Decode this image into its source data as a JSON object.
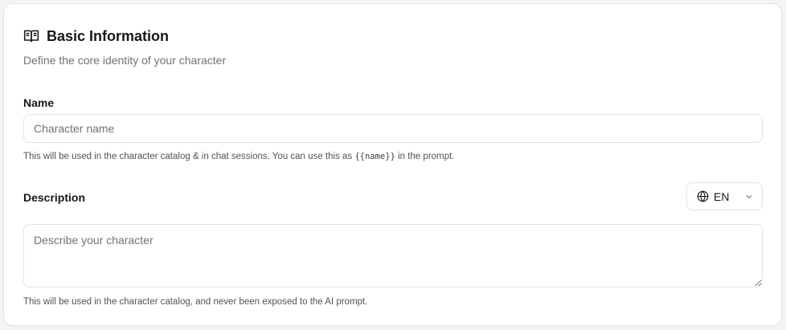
{
  "section": {
    "title": "Basic Information",
    "subtitle": "Define the core identity of your character",
    "icon": "book-open-icon"
  },
  "name_field": {
    "label": "Name",
    "placeholder": "Character name",
    "value": "",
    "hint_before": "This will be used in the character catalog & in chat sessions. You can use this as ",
    "hint_code": "{{name}}",
    "hint_after": " in the prompt."
  },
  "description_field": {
    "label": "Description",
    "placeholder": "Describe your character",
    "value": "",
    "hint": "This will be used in the character catalog, and never been exposed to the AI prompt."
  },
  "language_select": {
    "selected": "EN",
    "icon": "globe-icon"
  },
  "colors": {
    "border": "#e4e4e7",
    "text": "#18181b",
    "muted": "#71717a"
  }
}
